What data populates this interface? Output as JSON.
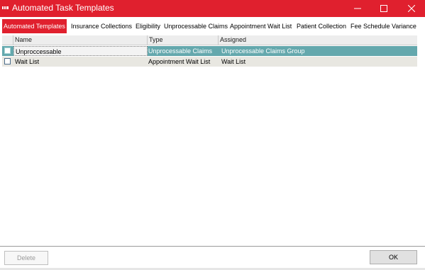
{
  "window": {
    "title": "Automated Task Templates",
    "accent_color": "#e0202e",
    "controls": [
      "minimize-icon",
      "maximize-icon",
      "close-icon"
    ]
  },
  "tabs": [
    {
      "label": "Automated Templates",
      "active": true
    },
    {
      "label": "Insurance Collections",
      "active": false
    },
    {
      "label": "Eligibility",
      "active": false
    },
    {
      "label": "Unprocessable Claims",
      "active": false
    },
    {
      "label": "Appointment Wait List",
      "active": false
    },
    {
      "label": "Patient Collection",
      "active": false
    },
    {
      "label": "Fee Schedule Variance",
      "active": false
    }
  ],
  "grid": {
    "columns": [
      "Name",
      "Type",
      "Assigned"
    ],
    "rows": [
      {
        "checked": false,
        "name": "Unproccessable",
        "type": "Unprocessable Claims",
        "assigned": "Unprocessable Claims Group",
        "selected": true
      },
      {
        "checked": false,
        "name": "Wait List",
        "type": "Appointment Wait List",
        "assigned": "Wait List",
        "selected": false
      }
    ],
    "selected_row_color": "#64a8ad"
  },
  "footer": {
    "delete_label": "Delete",
    "delete_enabled": false,
    "ok_label": "OK"
  }
}
